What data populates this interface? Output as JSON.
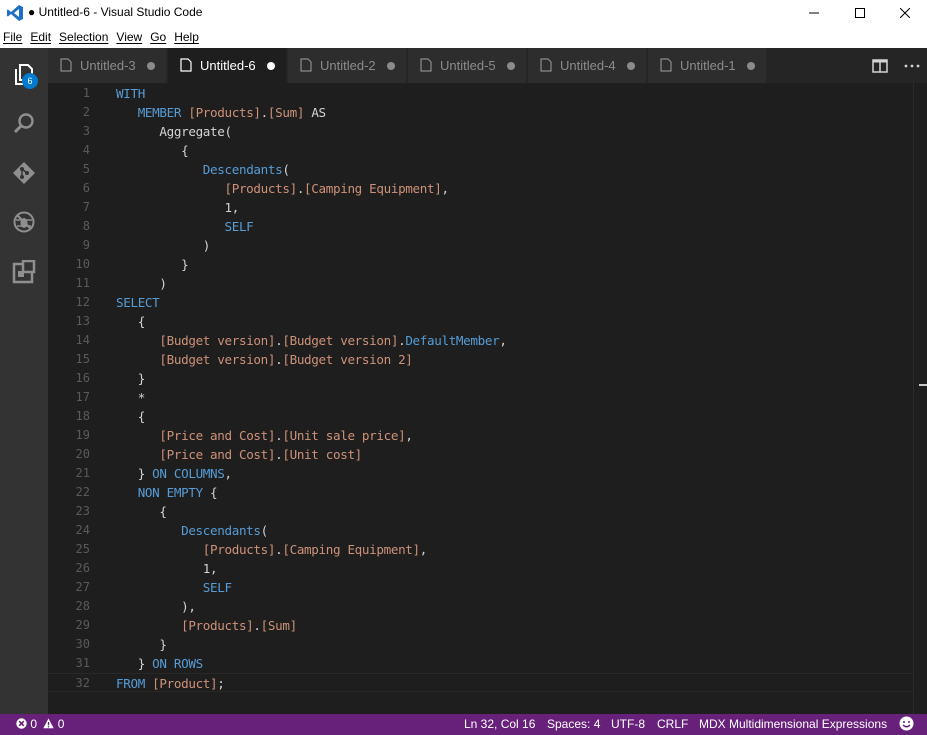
{
  "window": {
    "title": "● Untitled-6 - Visual Studio Code"
  },
  "menu": [
    "File",
    "Edit",
    "Selection",
    "View",
    "Go",
    "Help"
  ],
  "activity": {
    "explorer_badge": "6",
    "icons": [
      "files-icon",
      "search-icon",
      "git-icon",
      "debug-icon",
      "extensions-icon"
    ]
  },
  "tabs": [
    {
      "label": "Untitled-3",
      "dirty": true,
      "active": false
    },
    {
      "label": "Untitled-6",
      "dirty": true,
      "active": true
    },
    {
      "label": "Untitled-2",
      "dirty": true,
      "active": false
    },
    {
      "label": "Untitled-5",
      "dirty": true,
      "active": false
    },
    {
      "label": "Untitled-4",
      "dirty": true,
      "active": false
    },
    {
      "label": "Untitled-1",
      "dirty": true,
      "active": false
    }
  ],
  "editor": {
    "language": "MDX",
    "current_line": 32,
    "lines": [
      "WITH",
      "   MEMBER [Products].[Sum] AS",
      "      Aggregate(",
      "         {",
      "            Descendants(",
      "               [Products].[Camping Equipment],",
      "               1,",
      "               SELF",
      "            )",
      "         }",
      "      )",
      "SELECT",
      "   {",
      "      [Budget version].[Budget version].DefaultMember,",
      "      [Budget version].[Budget version 2]",
      "   }",
      "   *",
      "   {",
      "      [Price and Cost].[Unit sale price],",
      "      [Price and Cost].[Unit cost]",
      "   } ON COLUMNS,",
      "   NON EMPTY {",
      "      {",
      "         Descendants(",
      "            [Products].[Camping Equipment],",
      "            1,",
      "            SELF",
      "         ),",
      "         [Products].[Sum]",
      "      }",
      "   } ON ROWS",
      "FROM [Product];"
    ]
  },
  "statusbar": {
    "errors": "0",
    "warnings": "0",
    "position": "Ln 32, Col 16",
    "indent": "Spaces: 4",
    "encoding": "UTF-8",
    "eol": "CRLF",
    "language_mode": "MDX Multidimensional Expressions"
  },
  "colors": {
    "keyword": "#569cd6",
    "identifier": "#ce9178",
    "plain": "#d4d4d4",
    "status_bar": "#68217a",
    "activity_bar": "#333333",
    "editor_bg": "#1e1e1e"
  }
}
